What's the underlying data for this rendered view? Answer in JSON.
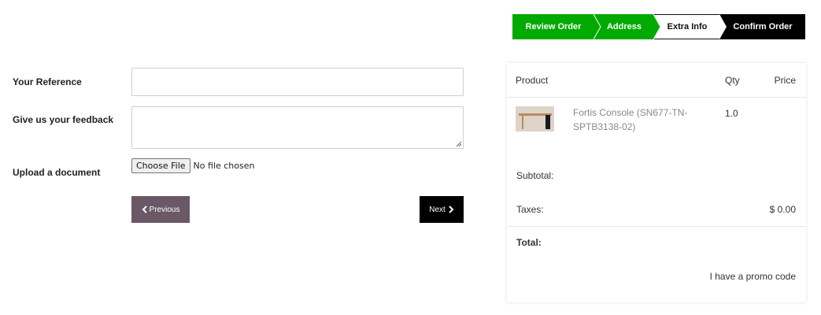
{
  "steps": [
    {
      "label": "Review Order",
      "state": "done"
    },
    {
      "label": "Address",
      "state": "done"
    },
    {
      "label": "Extra Info",
      "state": "current"
    },
    {
      "label": "Confirm Order",
      "state": "upcoming"
    }
  ],
  "colors": {
    "done": "#00aa00",
    "upcoming": "#000000",
    "previous_button": "#6b5867",
    "next_button": "#000000"
  },
  "form": {
    "reference_label": "Your Reference",
    "reference_value": "",
    "feedback_label": "Give us your feedback",
    "feedback_value": "",
    "upload_label": "Upload a document",
    "choose_file_label": "Choose File",
    "file_status": "No file chosen",
    "previous_label": "Previous",
    "next_label": "Next"
  },
  "summary": {
    "col_product": "Product",
    "col_qty": "Qty",
    "col_price": "Price",
    "items": [
      {
        "name": "Fortis Console (SN677-TN-SPTB3138-02)",
        "qty": "1.0",
        "price": ""
      }
    ],
    "subtotal_label": "Subtotal:",
    "subtotal_value": "",
    "taxes_label": "Taxes:",
    "taxes_value": "$ 0.00",
    "total_label": "Total:",
    "total_value": "",
    "promo_label": "I have a promo code"
  }
}
